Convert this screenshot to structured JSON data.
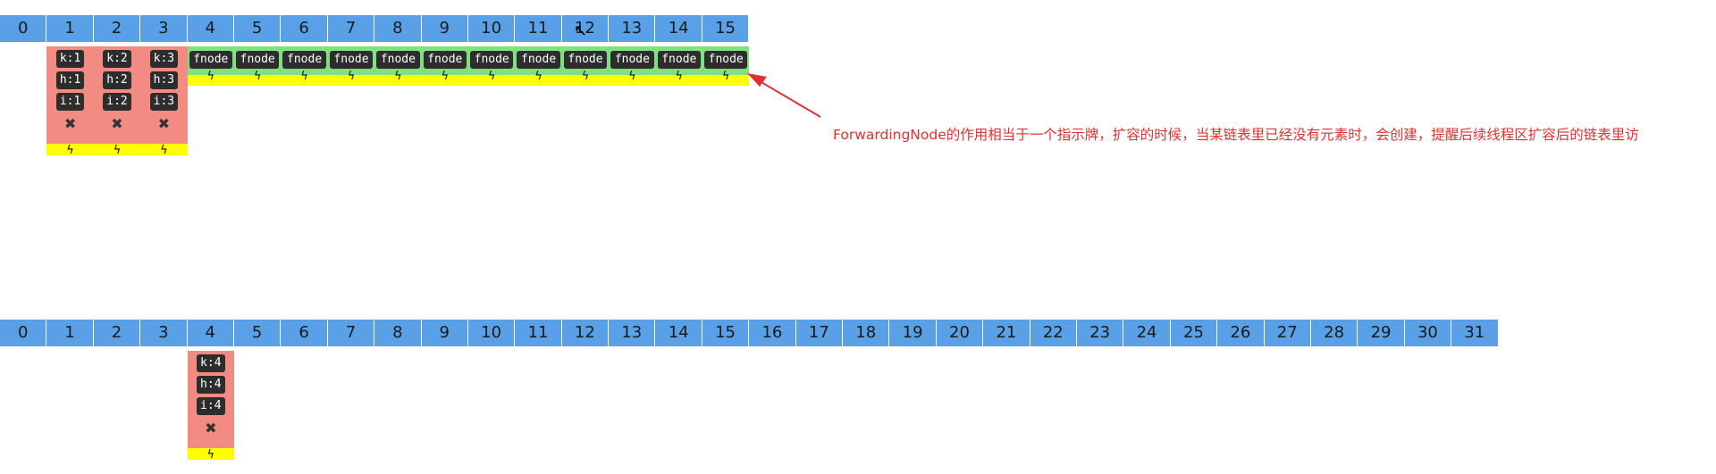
{
  "top_array": {
    "indices": [
      "0",
      "1",
      "2",
      "3",
      "4",
      "5",
      "6",
      "7",
      "8",
      "9",
      "10",
      "11",
      "12",
      "13",
      "14",
      "15"
    ]
  },
  "top_chains": [
    {
      "k": "k:1",
      "h": "h:1",
      "i": "i:1"
    },
    {
      "k": "k:2",
      "h": "h:2",
      "i": "i:2"
    },
    {
      "k": "k:3",
      "h": "h:3",
      "i": "i:3"
    }
  ],
  "fnode_label": "fnode",
  "annotation": "ForwardingNode的作用相当于一个指示牌，扩容的时候，当某链表里已经没有元素时，会创建，提醒后续线程区扩容后的链表里访",
  "bottom_array": {
    "indices": [
      "0",
      "1",
      "2",
      "3",
      "4",
      "5",
      "6",
      "7",
      "8",
      "9",
      "10",
      "11",
      "12",
      "13",
      "14",
      "15",
      "16",
      "17",
      "18",
      "19",
      "20",
      "21",
      "22",
      "23",
      "24",
      "25",
      "26",
      "27",
      "28",
      "29",
      "30",
      "31"
    ]
  },
  "bottom_chain": {
    "k": "k:4",
    "h": "h:4",
    "i": "i:4"
  },
  "icons": {
    "cross": "broken-link-icon",
    "bolt": "lightning-icon",
    "cursor": "mouse-cursor-icon"
  },
  "colors": {
    "cell": "#5aa0e6",
    "node": "#f28b82",
    "fnode_bg": "#7ee07e",
    "marker": "#ffff00",
    "annotation": "#e03030"
  }
}
